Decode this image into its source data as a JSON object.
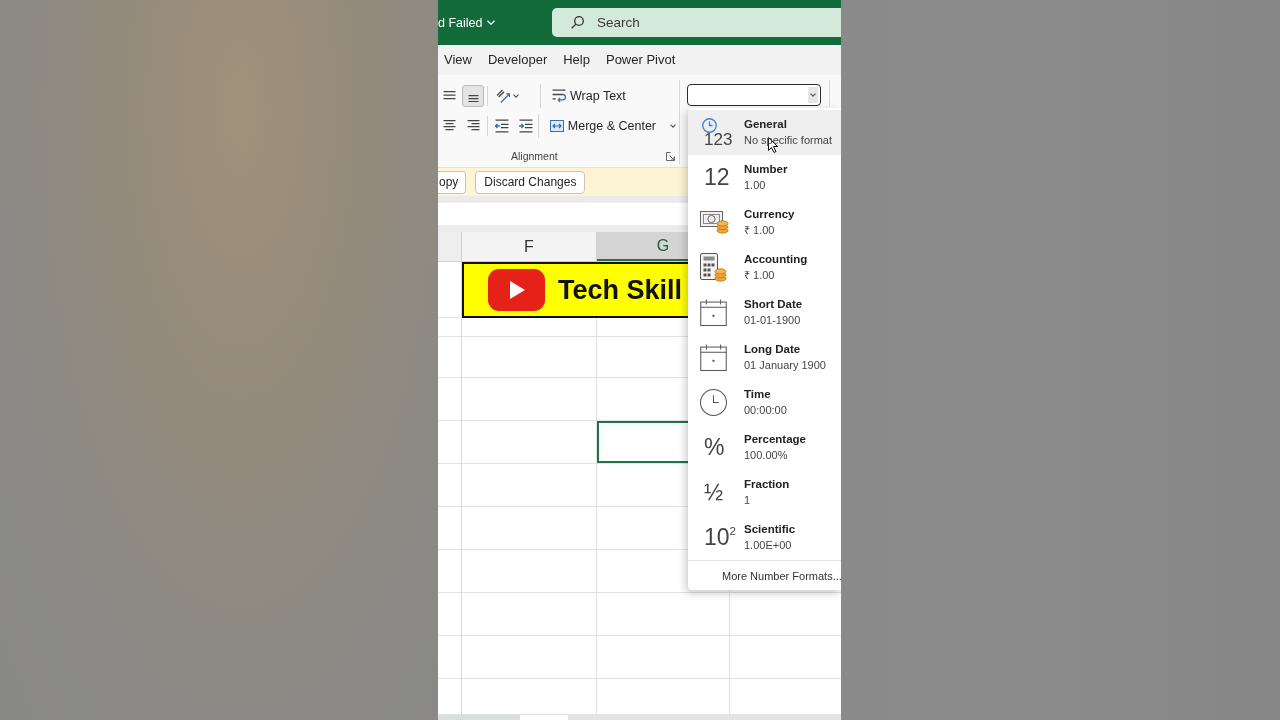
{
  "title_bar": {
    "file_status": "d Failed",
    "search": {
      "placeholder": "Search"
    }
  },
  "ribbon_tabs": [
    {
      "label": "View",
      "selected": false
    },
    {
      "label": "Developer",
      "selected": false
    },
    {
      "label": "Help",
      "selected": false
    },
    {
      "label": "Power Pivot",
      "selected": false
    }
  ],
  "ribbon": {
    "alignment_group": {
      "label": "Alignment",
      "rows": [
        {
          "buttons": [
            {
              "kind": "align-middle",
              "selected": false
            },
            {
              "kind": "align-bottom",
              "selected": true
            },
            {
              "kind": "orientation",
              "selected": false
            }
          ],
          "command": {
            "kind": "wrap",
            "label": "Wrap Text"
          }
        },
        {
          "buttons": [
            {
              "kind": "align-center",
              "selected": false
            },
            {
              "kind": "align-right",
              "selected": false
            },
            {
              "kind": "indent-decrease",
              "selected": false
            },
            {
              "kind": "indent-increase",
              "selected": false
            }
          ],
          "command": {
            "kind": "merge",
            "label": "Merge & Center"
          }
        }
      ]
    },
    "number_format": {
      "expanded": true,
      "options": [
        {
          "kind": "general",
          "glyph": "123",
          "label": "General",
          "sample": "No specific format",
          "selected": true
        },
        {
          "kind": "glyph",
          "glyph": "12",
          "label": "Number",
          "sample": "1.00",
          "selected": false
        },
        {
          "kind": "currency",
          "label": "Currency",
          "sample": "₹ 1.00",
          "selected": false
        },
        {
          "kind": "accounting",
          "label": "Accounting",
          "sample": "₹ 1.00",
          "selected": false
        },
        {
          "kind": "calendar",
          "label": "Short Date",
          "sample": "01-01-1900",
          "selected": false
        },
        {
          "kind": "calendar",
          "label": "Long Date",
          "sample": "01 January 1900",
          "selected": false
        },
        {
          "kind": "clock",
          "label": "Time",
          "sample": "00:00:00",
          "selected": false
        },
        {
          "kind": "glyph",
          "glyph": "%",
          "label": "Percentage",
          "sample": "100.00%",
          "selected": false
        },
        {
          "kind": "glyph",
          "glyph": "½",
          "label": "Fraction",
          "sample": "1",
          "selected": false
        },
        {
          "kind": "glyph",
          "glyph": "10$^{2}$",
          "label": "Scientific",
          "sample": "1.00E+00",
          "selected": false
        }
      ],
      "more_formats": "More Number Formats..."
    }
  },
  "message_bar": {
    "buttons": [
      "opy",
      "Discard Changes"
    ]
  },
  "sheet": {
    "columns": [
      {
        "label": "F",
        "selected": false
      },
      {
        "label": "G",
        "selected": true
      }
    ],
    "banner": {
      "text": "Tech Skill"
    },
    "rows": [
      {
        "cells": [
          {
            "selected": false
          },
          {
            "selected": false
          }
        ]
      },
      {
        "cells": [
          {
            "selected": false
          },
          {
            "selected": false
          }
        ]
      },
      {
        "cells": [
          {
            "selected": false
          },
          {
            "selected": false
          }
        ]
      },
      {
        "cells": [
          {
            "selected": false
          },
          {
            "selected": true
          }
        ]
      },
      {
        "cells": [
          {
            "selected": false
          },
          {
            "selected": false
          }
        ]
      },
      {
        "cells": [
          {
            "selected": false
          },
          {
            "selected": false
          }
        ]
      },
      {
        "cells": [
          {
            "selected": false
          },
          {
            "selected": false
          }
        ]
      },
      {
        "cells": [
          {
            "selected": false
          },
          {
            "selected": false
          }
        ]
      },
      {
        "cells": [
          {
            "selected": false
          },
          {
            "selected": false
          }
        ]
      },
      {
        "cells": [
          {
            "selected": false
          },
          {
            "selected": false
          }
        ]
      }
    ]
  }
}
